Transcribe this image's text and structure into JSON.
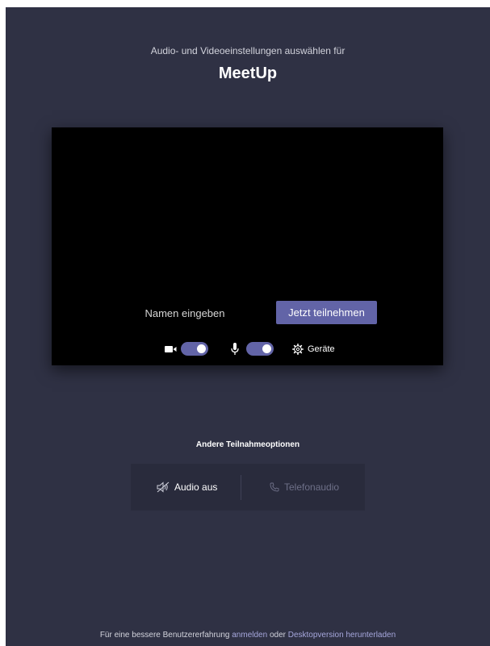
{
  "header": {
    "subtitle": "Audio- und Videoeinstellungen auswählen für",
    "title": "MeetUp"
  },
  "preview": {
    "name_placeholder": "Namen eingeben",
    "join_label": "Jetzt teilnehmen",
    "camera": {
      "icon": "camera-icon",
      "enabled": true
    },
    "microphone": {
      "icon": "microphone-icon",
      "enabled": true
    },
    "devices_label": "Geräte",
    "devices_icon": "gear-icon"
  },
  "other_options": {
    "heading": "Andere Teilnahmeoptionen",
    "audio_off_label": "Audio aus",
    "audio_off_icon": "speaker-muted-icon",
    "phone_audio_label": "Telefonaudio",
    "phone_audio_icon": "phone-icon"
  },
  "footer": {
    "prefix": "Für eine bessere Benutzererfahrung",
    "sign_in_link": "anmelden",
    "conjunction": "oder",
    "download_link": "Desktopversion herunterladen"
  },
  "colors": {
    "background": "#2f3144",
    "accent": "#6264a7",
    "preview": "#000000",
    "link": "#a6a7dc"
  }
}
